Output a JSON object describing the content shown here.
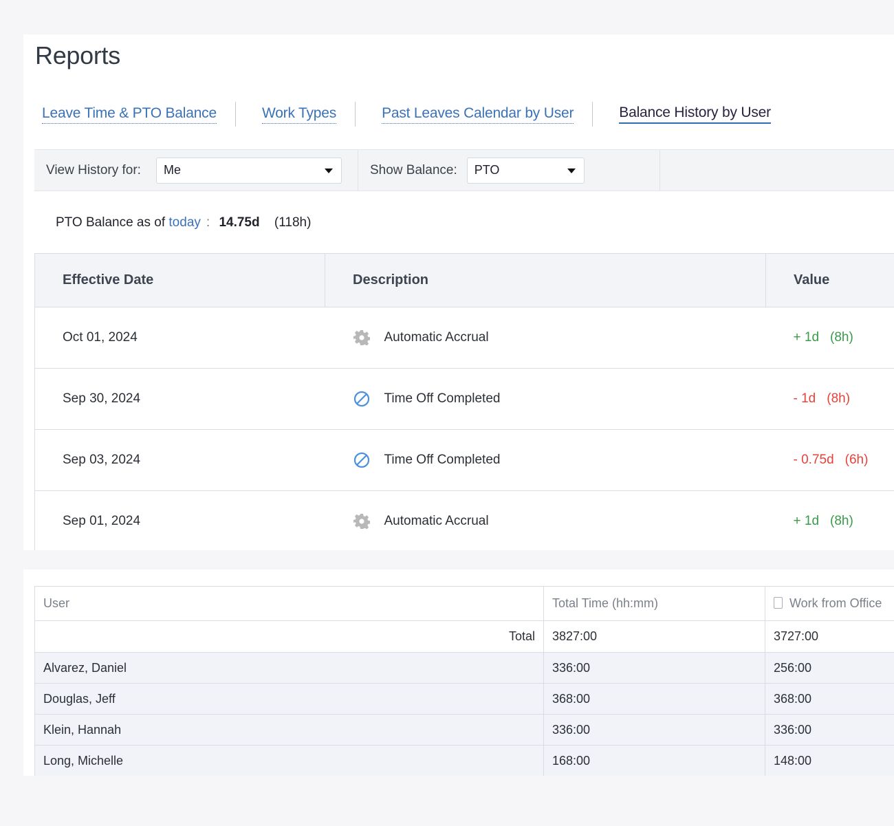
{
  "page": {
    "title": "Reports"
  },
  "tabs": [
    {
      "label": "Leave Time & PTO Balance",
      "active": false
    },
    {
      "label": "Work Types",
      "active": false
    },
    {
      "label": "Past Leaves Calendar by User",
      "active": false
    },
    {
      "label": "Balance History by User",
      "active": true
    }
  ],
  "filters": {
    "view_history_label": "View History for:",
    "view_history_value": "Me",
    "show_balance_label": "Show Balance:",
    "show_balance_value": "PTO"
  },
  "balance": {
    "prefix": "PTO Balance as of",
    "link": "today",
    "colon": ":",
    "days": "14.75d",
    "hours": "(118h)"
  },
  "history_table": {
    "headers": [
      "Effective Date",
      "Description",
      "Value"
    ],
    "rows": [
      {
        "date": "Oct 01, 2024",
        "icon": "gear-icon",
        "description": "Automatic Accrual",
        "value_days": "+ 1d",
        "value_hours": "(8h)",
        "sign": "positive"
      },
      {
        "date": "Sep 30, 2024",
        "icon": "prohibited-icon",
        "description": "Time Off Completed",
        "value_days": "- 1d",
        "value_hours": "(8h)",
        "sign": "negative"
      },
      {
        "date": "Sep 03, 2024",
        "icon": "prohibited-icon",
        "description": "Time Off Completed",
        "value_days": "- 0.75d",
        "value_hours": "(6h)",
        "sign": "negative"
      },
      {
        "date": "Sep 01, 2024",
        "icon": "gear-icon",
        "description": "Automatic Accrual",
        "value_days": "+ 1d",
        "value_hours": "(8h)",
        "sign": "positive"
      }
    ]
  },
  "users_table": {
    "headers": [
      "User",
      "Total Time (hh:mm)",
      "Work from Office"
    ],
    "total": {
      "label": "Total",
      "total_time": "3827:00",
      "work_from_office": "3727:00"
    },
    "rows": [
      {
        "user": "Alvarez, Daniel",
        "total_time": "336:00",
        "work_from_office": "256:00"
      },
      {
        "user": "Douglas, Jeff",
        "total_time": "368:00",
        "work_from_office": "368:00"
      },
      {
        "user": "Klein, Hannah",
        "total_time": "336:00",
        "work_from_office": "336:00"
      },
      {
        "user": "Long, Michelle",
        "total_time": "168:00",
        "work_from_office": "148:00"
      }
    ]
  },
  "colors": {
    "link": "#3a72b8",
    "positive": "#3a9a4a",
    "negative": "#e8413a",
    "gear_icon": "#b8b8b8",
    "prohibited_icon": "#4a90e2"
  }
}
